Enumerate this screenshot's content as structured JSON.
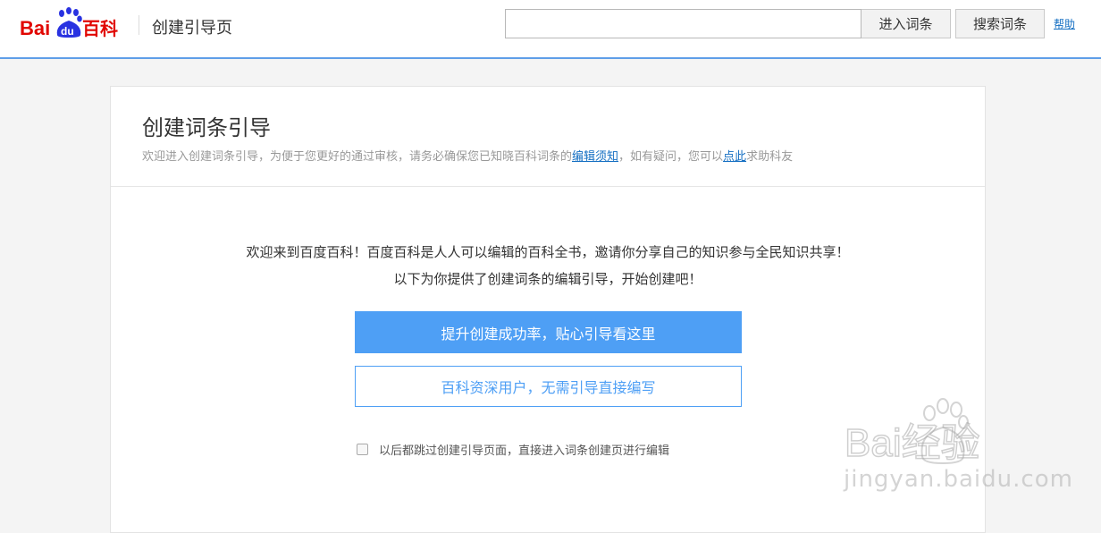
{
  "header": {
    "logo_left": "Bai",
    "logo_paw": "du",
    "logo_right": "百科",
    "page_title": "创建引导页",
    "search_value": "",
    "search_placeholder": "",
    "enter_button": "进入词条",
    "search_button": "搜索词条",
    "help_link": "帮助"
  },
  "card": {
    "title": "创建词条引导",
    "desc_part1": "欢迎进入创建词条引导，为便于您更好的通过审核，请务必确保您已知晓百科词条的",
    "desc_link1": "编辑须知",
    "desc_part2": "，如有疑问，您可以",
    "desc_link2": "点此",
    "desc_part3": "求助科友",
    "welcome_line1": "欢迎来到百度百科！百度百科是人人可以编辑的百科全书，邀请你分享自己的知识参与全民知识共享！",
    "welcome_line2": "以下为你提供了创建词条的编辑引导，开始创建吧！",
    "primary_button": "提升创建成功率，贴心引导看这里",
    "secondary_button": "百科资深用户，无需引导直接编写",
    "skip_checkbox_checked": false,
    "skip_label": "以后都跳过创建引导页面，直接进入词条创建页进行编辑"
  },
  "watermark": {
    "logo_text": "Bai经验",
    "url": "jingyan.baidu.com"
  },
  "colors": {
    "brand_red": "#e10601",
    "paw_blue": "#2932e1",
    "accent_blue": "#4e9ff5",
    "link_blue": "#136ec2",
    "header_line": "#5f9ee8"
  }
}
